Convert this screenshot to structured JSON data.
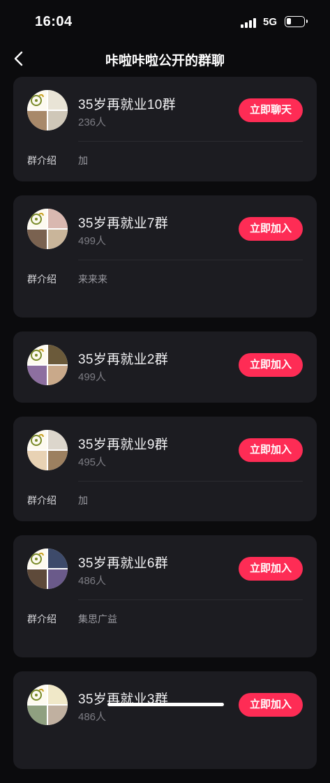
{
  "status": {
    "time": "16:04",
    "network": "5G"
  },
  "nav": {
    "title": "咔啦咔啦公开的群聊",
    "back_icon": "chevron-left-icon"
  },
  "groups": [
    {
      "name": "35岁再就业10群",
      "members": "236人",
      "action": "立即聊天",
      "intro_label": "群介绍",
      "intro": "加",
      "avatar_colors": [
        "#e9e4d6",
        "#a8896a",
        "#cfc7b8"
      ]
    },
    {
      "name": "35岁再就业7群",
      "members": "499人",
      "action": "立即加入",
      "intro_label": "群介绍",
      "intro": "来来来",
      "avatar_colors": [
        "#d9b8b0",
        "#7a6250",
        "#c9b59a"
      ]
    },
    {
      "name": "35岁再就业2群",
      "members": "499人",
      "action": "立即加入",
      "intro_label": "",
      "intro": "",
      "avatar_colors": [
        "#6b5a3a",
        "#8d6fa0",
        "#c9a98a"
      ]
    },
    {
      "name": "35岁再就业9群",
      "members": "495人",
      "action": "立即加入",
      "intro_label": "群介绍",
      "intro": "加",
      "avatar_colors": [
        "#dcd6cc",
        "#e8d2b4",
        "#9c8060"
      ]
    },
    {
      "name": "35岁再就业6群",
      "members": "486人",
      "action": "立即加入",
      "intro_label": "群介绍",
      "intro": "集思广益",
      "avatar_colors": [
        "#3d4a6a",
        "#5e4a3a",
        "#6a5a8a"
      ]
    },
    {
      "name": "35岁再就业3群",
      "members": "486人",
      "action": "立即加入",
      "intro_label": "",
      "intro": "",
      "avatar_colors": [
        "#f0e8c8",
        "#8fa080",
        "#c0b0a0"
      ]
    }
  ]
}
